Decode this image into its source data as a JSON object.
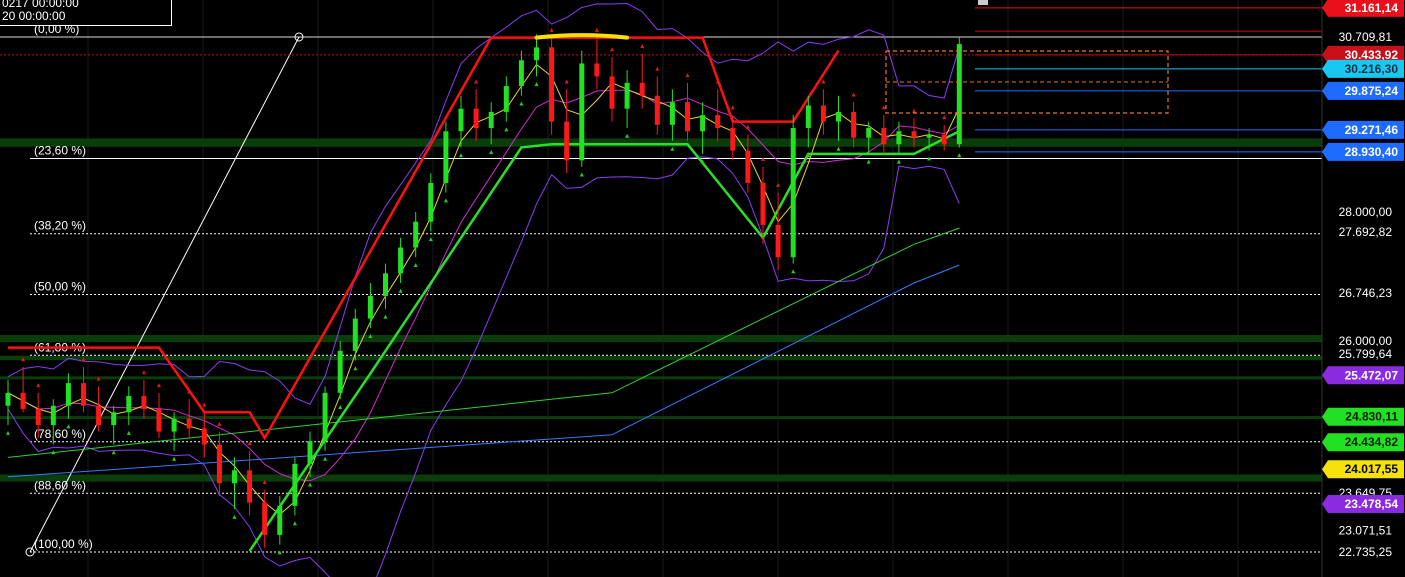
{
  "info_box": {
    "line1": "0217 00:00:00",
    "line2": "20 00:00:00"
  },
  "chart_data": {
    "type": "candlestick",
    "y_axis": {
      "min": 22500,
      "max": 31500,
      "labels": [
        {
          "value": 31161.14,
          "text": "31.161,14",
          "style": "tag",
          "bg": "#e8101a",
          "fg": "#ffffff"
        },
        {
          "value": 30709.81,
          "text": "30.709,81",
          "style": "plain"
        },
        {
          "value": 30433.92,
          "text": "30.433,92",
          "style": "tag",
          "bg": "#c8101a",
          "fg": "#ffffff"
        },
        {
          "value": 30216.3,
          "text": "30.216,30",
          "style": "tag",
          "bg": "#19c8f0",
          "fg": "#003040"
        },
        {
          "value": 29875.24,
          "text": "29.875,24",
          "style": "tag",
          "bg": "#1e6cff",
          "fg": "#ffffff"
        },
        {
          "value": 29271.46,
          "text": "29.271,46",
          "style": "tag",
          "bg": "#1e6cff",
          "fg": "#ffffff"
        },
        {
          "value": 28930.4,
          "text": "28.930,40",
          "style": "tag",
          "bg": "#1e6cff",
          "fg": "#ffffff"
        },
        {
          "value": 28000.0,
          "text": "28.000,00",
          "style": "plain"
        },
        {
          "value": 27692.82,
          "text": "27.692,82",
          "style": "plain"
        },
        {
          "value": 26746.23,
          "text": "26.746,23",
          "style": "plain"
        },
        {
          "value": 26000.0,
          "text": "26.000,00",
          "style": "plain"
        },
        {
          "value": 25799.64,
          "text": "25.799,64",
          "style": "plain"
        },
        {
          "value": 25472.07,
          "text": "25.472,07",
          "style": "tag",
          "bg": "#8a2be2",
          "fg": "#ffffff"
        },
        {
          "value": 24830.11,
          "text": "24.830,11",
          "style": "tag",
          "bg": "#22e022",
          "fg": "#002000"
        },
        {
          "value": 24434.82,
          "text": "24.434,82",
          "style": "tag",
          "bg": "#22e022",
          "fg": "#002000"
        },
        {
          "value": 24017.55,
          "text": "24.017,55",
          "style": "tag",
          "bg": "#f5e20a",
          "fg": "#000000"
        },
        {
          "value": 23649.75,
          "text": "23.649,75",
          "style": "plain"
        },
        {
          "value": 23478.54,
          "text": "23.478,54",
          "style": "tag",
          "bg": "#8a2be2",
          "fg": "#ffffff"
        },
        {
          "value": 23071.51,
          "text": "23.071,51",
          "style": "plain"
        },
        {
          "value": 22735.25,
          "text": "22.735,25",
          "style": "plain"
        }
      ]
    },
    "fibonacci": {
      "high": 30709.81,
      "low": 22735.25,
      "levels": [
        {
          "ratio": 0.0,
          "text": "(0,00 %)"
        },
        {
          "ratio": 0.236,
          "text": "(23,60 %)"
        },
        {
          "ratio": 0.382,
          "text": "(38,20 %)"
        },
        {
          "ratio": 0.5,
          "text": "(50,00 %)"
        },
        {
          "ratio": 0.618,
          "text": "(61,80 %)"
        },
        {
          "ratio": 0.786,
          "text": "(78,60 %)"
        },
        {
          "ratio": 0.886,
          "text": "(88,60 %)"
        },
        {
          "ratio": 1.0,
          "text": "(100,00 %)"
        }
      ]
    },
    "zones": [
      {
        "value": 29075,
        "thickness": 130
      },
      {
        "value": 26040,
        "thickness": 110
      },
      {
        "value": 25740,
        "thickness": 70
      },
      {
        "value": 25435,
        "thickness": 40
      },
      {
        "value": 24820,
        "thickness": 40
      },
      {
        "value": 23880,
        "thickness": 110
      }
    ],
    "horizontal_lines": [
      {
        "value": 31161.14,
        "color": "#e8101a"
      },
      {
        "value": 30709.81,
        "color": "#dddddd"
      },
      {
        "value": 30800,
        "color": "#c0101a"
      },
      {
        "value": 30433.92,
        "color": "#c0101a"
      },
      {
        "value": 30216.3,
        "color": "#19c8f0"
      },
      {
        "value": 29875.24,
        "color": "#1e6cff"
      },
      {
        "value": 29271.46,
        "color": "#1e6cff"
      },
      {
        "value": 28930.4,
        "color": "#1e6cff"
      }
    ],
    "candles": [
      [
        25000,
        25400,
        24700,
        25200
      ],
      [
        25200,
        25600,
        24900,
        24950
      ],
      [
        24950,
        25200,
        24500,
        24700
      ],
      [
        24700,
        25100,
        24400,
        25000
      ],
      [
        25000,
        25500,
        24800,
        25350
      ],
      [
        25350,
        25600,
        24900,
        25000
      ],
      [
        25000,
        25300,
        24600,
        24700
      ],
      [
        24700,
        25000,
        24400,
        24900
      ],
      [
        24900,
        25300,
        24700,
        25150
      ],
      [
        25150,
        25400,
        24800,
        24950
      ],
      [
        24950,
        25200,
        24500,
        24600
      ],
      [
        24600,
        24900,
        24300,
        24800
      ],
      [
        24800,
        25100,
        24500,
        24650
      ],
      [
        24650,
        24900,
        24200,
        24400
      ],
      [
        24400,
        24600,
        23600,
        23800
      ],
      [
        23800,
        24200,
        23400,
        24000
      ],
      [
        24000,
        24300,
        23300,
        23500
      ],
      [
        23500,
        23700,
        22800,
        23000
      ],
      [
        23000,
        23600,
        22850,
        23450
      ],
      [
        23450,
        24200,
        23300,
        24100
      ],
      [
        24100,
        24600,
        23900,
        24450
      ],
      [
        24450,
        25300,
        24300,
        25200
      ],
      [
        25200,
        26000,
        25100,
        25850
      ],
      [
        25850,
        26500,
        25700,
        26350
      ],
      [
        26350,
        26900,
        26200,
        26700
      ],
      [
        26700,
        27200,
        26500,
        27050
      ],
      [
        27050,
        27600,
        26900,
        27450
      ],
      [
        27450,
        28000,
        27300,
        27850
      ],
      [
        27850,
        28600,
        27700,
        28450
      ],
      [
        28450,
        29400,
        28300,
        29250
      ],
      [
        29250,
        29800,
        29000,
        29600
      ],
      [
        29600,
        29900,
        29100,
        29300
      ],
      [
        29300,
        29700,
        29050,
        29550
      ],
      [
        29550,
        30100,
        29400,
        29950
      ],
      [
        29950,
        30500,
        29800,
        30350
      ],
      [
        30350,
        30750,
        30100,
        30550
      ],
      [
        30550,
        30700,
        29200,
        29400
      ],
      [
        29400,
        29900,
        28600,
        28800
      ],
      [
        28800,
        30500,
        28700,
        30300
      ],
      [
        30300,
        30700,
        29900,
        30100
      ],
      [
        30100,
        30400,
        29400,
        29600
      ],
      [
        29600,
        30200,
        29300,
        30000
      ],
      [
        30000,
        30450,
        29600,
        29800
      ],
      [
        29800,
        30100,
        29200,
        29350
      ],
      [
        29350,
        29900,
        29100,
        29700
      ],
      [
        29700,
        30000,
        29100,
        29250
      ],
      [
        29250,
        29700,
        28900,
        29500
      ],
      [
        29500,
        29900,
        29100,
        29300
      ],
      [
        29300,
        29500,
        28800,
        28950
      ],
      [
        28950,
        29200,
        28300,
        28450
      ],
      [
        28450,
        28700,
        27500,
        27800
      ],
      [
        27800,
        28300,
        27100,
        27300
      ],
      [
        27300,
        29500,
        27200,
        29300
      ],
      [
        29300,
        29800,
        29000,
        29650
      ],
      [
        29650,
        29900,
        29200,
        29400
      ],
      [
        29400,
        29800,
        29100,
        29550
      ],
      [
        29550,
        29700,
        29000,
        29150
      ],
      [
        29150,
        29400,
        28900,
        29300
      ],
      [
        29300,
        29500,
        28900,
        29050
      ],
      [
        29050,
        29400,
        28900,
        29250
      ],
      [
        29250,
        29450,
        29000,
        29150
      ],
      [
        29150,
        29300,
        28950,
        29200
      ],
      [
        29200,
        29350,
        28950,
        29050
      ],
      [
        29050,
        30700,
        29000,
        30600
      ]
    ],
    "moving_averages": [
      {
        "color": "#3c78ff",
        "points": [
          [
            0,
            23900
          ],
          [
            40,
            24550
          ],
          [
            60,
            26900
          ],
          [
            63,
            27180
          ]
        ]
      },
      {
        "color": "#30d030",
        "points": [
          [
            0,
            24200
          ],
          [
            40,
            25200
          ],
          [
            60,
            27500
          ],
          [
            63,
            27750
          ]
        ]
      }
    ],
    "bollinger": {
      "upper_color": "#8a3cf0",
      "mid_color": "#d02ad0",
      "fast_color": "#e8d820"
    },
    "supertrend_red": [
      [
        0,
        25900
      ],
      [
        10,
        25900
      ],
      [
        13,
        24900
      ],
      [
        16,
        24900
      ],
      [
        17,
        24500
      ],
      [
        32,
        30700
      ],
      [
        46,
        30700
      ],
      [
        48,
        29400
      ],
      [
        52,
        29400
      ],
      [
        55,
        30500
      ]
    ],
    "supertrend_green": [
      [
        16,
        22750
      ],
      [
        24,
        25500
      ],
      [
        34,
        29000
      ],
      [
        36,
        29050
      ],
      [
        45,
        29050
      ],
      [
        50,
        27600
      ],
      [
        53,
        28900
      ],
      [
        60,
        28900
      ],
      [
        63,
        29250
      ]
    ],
    "highlight_marker": {
      "value": 30700,
      "from": 35,
      "to": 41,
      "color": "#ffe000"
    },
    "fib_trendline": {
      "from_index": 2,
      "from_value": 22735.25,
      "to_index": 19,
      "to_value": 30709.81
    }
  }
}
